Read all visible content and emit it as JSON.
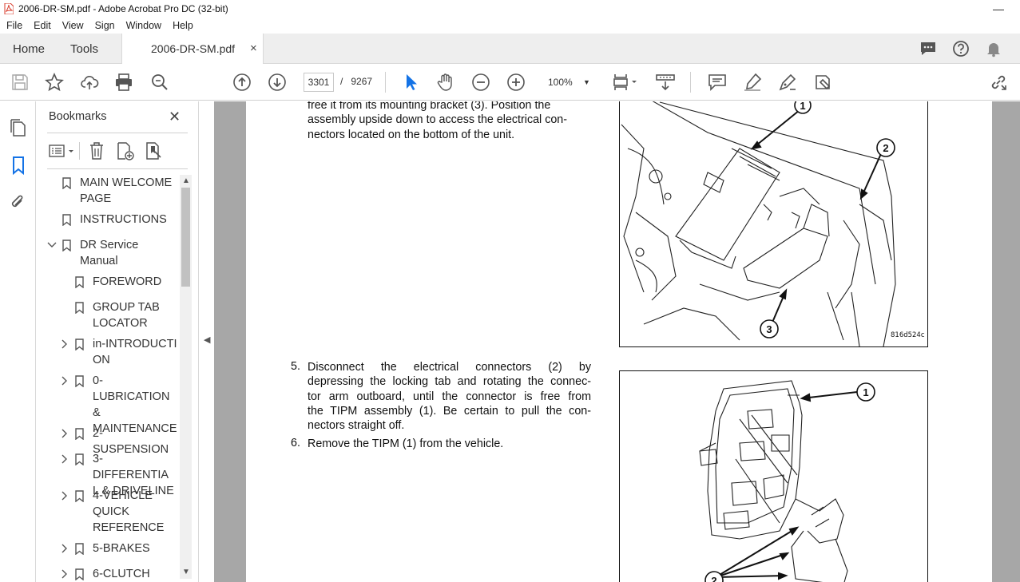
{
  "window": {
    "title": "2006-DR-SM.pdf - Adobe Acrobat Pro DC (32-bit)",
    "minimize_glyph": "—"
  },
  "menu": [
    "File",
    "Edit",
    "View",
    "Sign",
    "Window",
    "Help"
  ],
  "tabs": {
    "home": "Home",
    "tools": "Tools",
    "document": "2006-DR-SM.pdf",
    "close_glyph": "×"
  },
  "toolbar": {
    "current_page": "3301",
    "page_separator": "/",
    "total_pages": "9267",
    "zoom": "100%"
  },
  "bookmarks": {
    "title": "Bookmarks",
    "close_glyph": "✕",
    "items": [
      {
        "label": "MAIN WELCOME PAGE",
        "lines": [
          "MAIN WELCOME",
          "PAGE"
        ],
        "level": 0,
        "expander": ""
      },
      {
        "label": "INSTRUCTIONS",
        "lines": [
          "INSTRUCTIONS"
        ],
        "level": 0,
        "expander": ""
      },
      {
        "label": "DR Service Manual",
        "lines": [
          "DR Service",
          "Manual"
        ],
        "level": 0,
        "expander": "expanded"
      },
      {
        "label": "FOREWORD",
        "lines": [
          "FOREWORD"
        ],
        "level": 1,
        "expander": ""
      },
      {
        "label": "GROUP TAB LOCATOR",
        "lines": [
          "GROUP TAB",
          "LOCATOR"
        ],
        "level": 1,
        "expander": ""
      },
      {
        "label": "in-INTRODUCTION",
        "lines": [
          "in-INTRODUCTI",
          "ON"
        ],
        "level": 1,
        "expander": "collapsed"
      },
      {
        "label": "0-LUBRICATION & MAINTENANCE",
        "lines": [
          "0-LUBRICATION",
          "&",
          "MAINTENANCE"
        ],
        "level": 1,
        "expander": "collapsed"
      },
      {
        "label": "2-SUSPENSION",
        "lines": [
          "2-SUSPENSION"
        ],
        "level": 1,
        "expander": "collapsed"
      },
      {
        "label": "3-DIFFERENTIAL & DRIVELINE",
        "lines": [
          "3-DIFFERENTIA",
          "L & DRIVELINE"
        ],
        "level": 1,
        "expander": "collapsed"
      },
      {
        "label": "4-VEHICLE QUICK REFERENCE",
        "lines": [
          "4-VEHICLE",
          "QUICK",
          "REFERENCE"
        ],
        "level": 1,
        "expander": "collapsed"
      },
      {
        "label": "5-BRAKES",
        "lines": [
          "5-BRAKES"
        ],
        "level": 1,
        "expander": "collapsed"
      },
      {
        "label": "6-CLUTCH",
        "lines": [
          "6-CLUTCH"
        ],
        "level": 1,
        "expander": "collapsed"
      }
    ]
  },
  "document": {
    "intro_lines": [
      "free it from its mounting bracket (3). Position the",
      "assembly upside down to access the electrical con-",
      "nectors located on the bottom of the unit."
    ],
    "steps": [
      {
        "number": "5.",
        "lines": [
          "Disconnect the electrical connectors (2) by",
          "depressing the locking tab and rotating the connec-",
          "tor arm outboard, until the connector is free from",
          "the TIPM assembly (1). Be certain to pull the con-",
          "nectors straight off."
        ]
      },
      {
        "number": "6.",
        "lines": [
          "Remove the TIPM (1) from the vehicle."
        ]
      }
    ],
    "figure1": {
      "code": "816d524c",
      "callouts": [
        "1",
        "2",
        "3"
      ]
    },
    "figure2": {
      "callouts": [
        "1",
        "2"
      ]
    }
  }
}
